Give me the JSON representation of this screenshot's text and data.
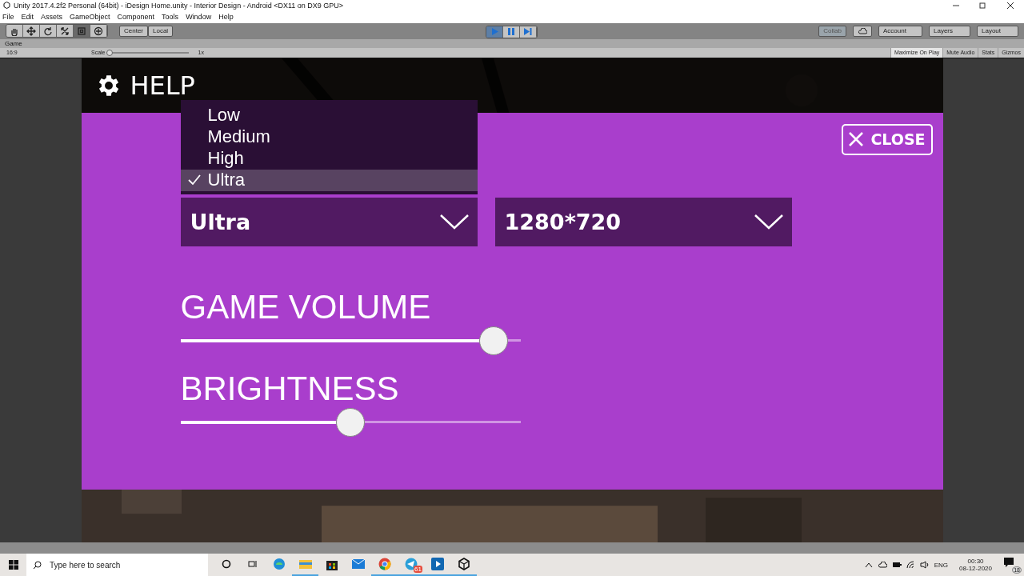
{
  "window": {
    "title": "Unity 2017.4.2f2 Personal (64bit) - iDesign Home.unity - Interior Design - Android <DX11 on DX9 GPU>"
  },
  "menu": [
    "File",
    "Edit",
    "Assets",
    "GameObject",
    "Component",
    "Tools",
    "Window",
    "Help"
  ],
  "toolbar": {
    "tools": [
      {
        "kind": "hand",
        "selected": false
      },
      {
        "kind": "move",
        "selected": false
      },
      {
        "kind": "rotate",
        "selected": false
      },
      {
        "kind": "scale",
        "selected": false
      },
      {
        "kind": "rect",
        "selected": true
      },
      {
        "kind": "transform",
        "selected": false
      }
    ],
    "pivot": [
      "Center",
      "Local"
    ],
    "playback": [
      {
        "kind": "play",
        "selected": true
      },
      {
        "kind": "pause",
        "selected": false
      },
      {
        "kind": "step",
        "selected": false
      }
    ],
    "collab": "Collab",
    "account": "Account",
    "layers": "Layers",
    "layout": "Layout"
  },
  "game_tab": {
    "title": "Game",
    "aspect": "16:9",
    "scale_label": "Scale",
    "scale_value": "1x",
    "scale": {
      "level": 0
    },
    "toggles": [
      {
        "label": "Maximize On Play",
        "selected": true
      },
      {
        "label": "Mute Audio",
        "selected": false
      },
      {
        "label": "Stats",
        "selected": false
      },
      {
        "label": "Gizmos",
        "selected": false
      }
    ]
  },
  "game": {
    "title": "HELP",
    "close": "CLOSE",
    "quality": {
      "value": "Ultra",
      "options": [
        {
          "label": "Low",
          "selected": false
        },
        {
          "label": "Medium",
          "selected": false
        },
        {
          "label": "High",
          "selected": false
        },
        {
          "label": "Ultra",
          "selected": true
        }
      ]
    },
    "resolution": {
      "value": "1280*720"
    },
    "sliders": [
      {
        "label": "GAME VOLUME",
        "level": 0.96
      },
      {
        "label": "BRIGHTNESS",
        "level": 0.5
      }
    ]
  },
  "taskbar": {
    "search": {
      "placeholder": "Type here to search"
    },
    "apps": [
      {
        "kind": "cortana",
        "running": false
      },
      {
        "kind": "taskview",
        "running": false
      },
      {
        "kind": "edge",
        "running": false
      },
      {
        "kind": "explorer",
        "running": true
      },
      {
        "kind": "store",
        "running": false
      },
      {
        "kind": "mail",
        "running": false
      },
      {
        "kind": "chrome",
        "running": true
      },
      {
        "kind": "telegram",
        "running": true,
        "badge": "61"
      },
      {
        "kind": "player",
        "running": true
      },
      {
        "kind": "unity",
        "running": true
      }
    ],
    "language": "ENG",
    "time": "00:30",
    "date": "08-12-2020",
    "notifications": "18"
  }
}
